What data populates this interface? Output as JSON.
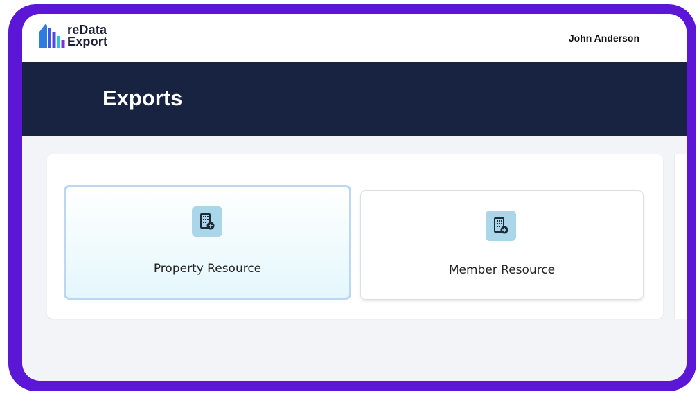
{
  "app": {
    "logo_line1": "reData",
    "logo_line2": "Export"
  },
  "header": {
    "user_name": "John Anderson"
  },
  "page": {
    "title": "Exports"
  },
  "resources": [
    {
      "label": "Property Resource",
      "icon": "building-add-icon",
      "selected": true
    },
    {
      "label": "Member Resource",
      "icon": "building-add-icon",
      "selected": false
    }
  ],
  "colors": {
    "frame": "#5b16d6",
    "banner": "#182241",
    "icon_tile": "#a9d6e8",
    "selected_border": "#bcd6f4"
  }
}
